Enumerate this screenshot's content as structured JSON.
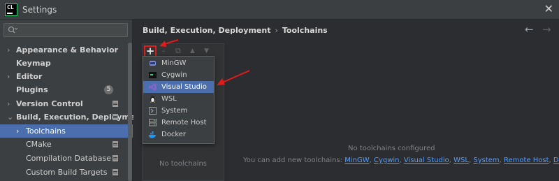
{
  "window": {
    "title": "Settings",
    "app_logo": "CL",
    "close": "✕"
  },
  "search": {
    "placeholder": "",
    "value": ""
  },
  "sidebar": {
    "items": [
      {
        "label": "Appearance & Behavior",
        "arrow": "›"
      },
      {
        "label": "Keymap"
      },
      {
        "label": "Editor",
        "arrow": "›"
      },
      {
        "label": "Plugins",
        "badge": "5"
      },
      {
        "label": "Version Control",
        "arrow": "›"
      },
      {
        "label": "Build, Execution, Deployment",
        "arrow": "⌄"
      },
      {
        "label": "Toolchains",
        "arrow": "›",
        "selected": true
      },
      {
        "label": "CMake"
      },
      {
        "label": "Compilation Database"
      },
      {
        "label": "Custom Build Targets"
      }
    ]
  },
  "breadcrumb": {
    "parent": "Build, Execution, Deployment",
    "separator": "›",
    "current": "Toolchains"
  },
  "nav": {
    "back": "←",
    "forward": "→"
  },
  "toolbar": {
    "add": "+",
    "remove": "–",
    "copy": "⧉",
    "up": "▲",
    "down": "▼"
  },
  "list": {
    "empty": "No toolchains"
  },
  "popup": {
    "items": [
      {
        "label": "MinGW",
        "icon": "mingw-icon"
      },
      {
        "label": "Cygwin",
        "icon": "cygwin-icon"
      },
      {
        "label": "Visual Studio",
        "icon": "visual-studio-icon",
        "selected": true
      },
      {
        "label": "WSL",
        "icon": "wsl-icon"
      },
      {
        "label": "System",
        "icon": "system-icon"
      },
      {
        "label": "Remote Host",
        "icon": "remote-host-icon"
      },
      {
        "label": "Docker",
        "icon": "docker-icon"
      }
    ]
  },
  "empty_state": {
    "title": "No toolchains configured",
    "hint_prefix": "You can add new toolchains:",
    "links": [
      "MinGW",
      "Cygwin",
      "Visual Studio",
      "WSL",
      "System",
      "Remote Host",
      "Docker"
    ]
  },
  "colors": {
    "accent": "#4b6eaf",
    "link": "#589df6",
    "annotation": "#e21b1b"
  }
}
